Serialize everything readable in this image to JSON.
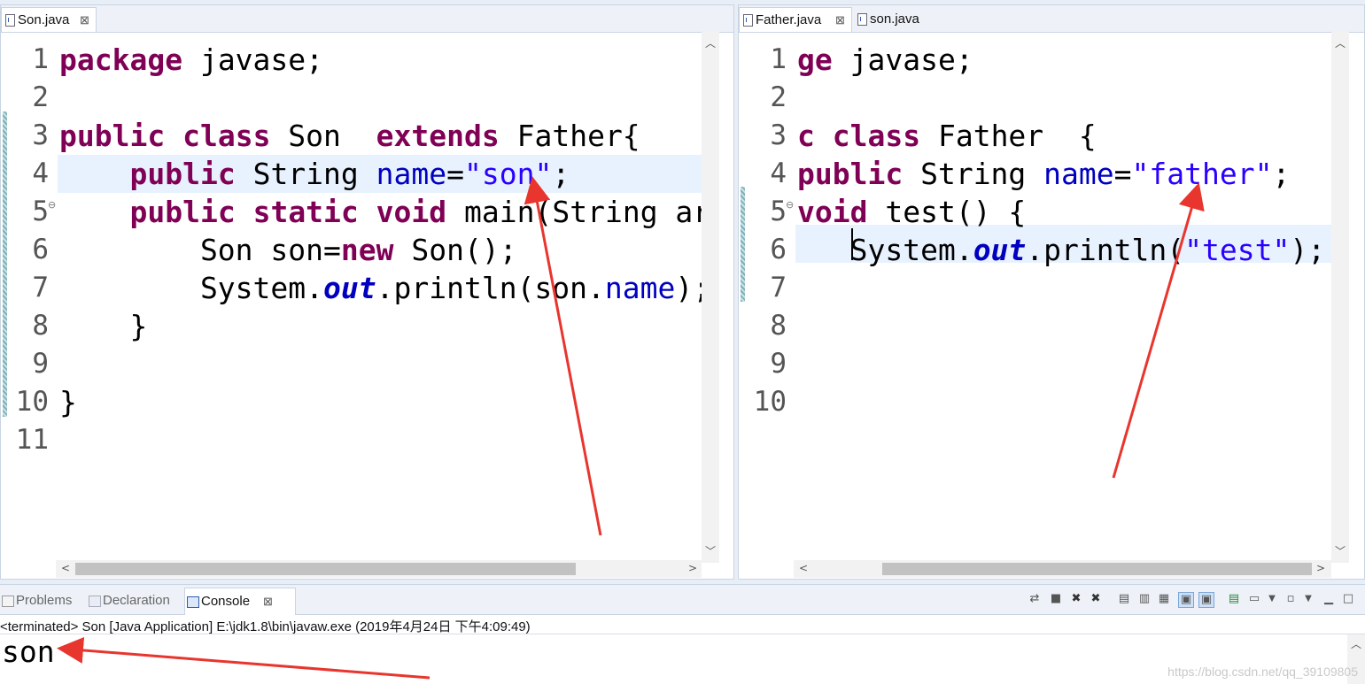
{
  "left_editor": {
    "tab_label": "Son.java",
    "close_glyph": "⊠",
    "line_numbers": [
      "1",
      "2",
      "3",
      "4",
      "5",
      "6",
      "7",
      "8",
      "9",
      "10",
      "11"
    ],
    "lines": [
      [
        {
          "t": "package",
          "c": "kw"
        },
        {
          "t": " javase;",
          "c": ""
        }
      ],
      [],
      [
        {
          "t": "public",
          "c": "kw"
        },
        {
          "t": " ",
          "c": ""
        },
        {
          "t": "class",
          "c": "kw"
        },
        {
          "t": " Son  ",
          "c": ""
        },
        {
          "t": "extends",
          "c": "kw"
        },
        {
          "t": " Father{",
          "c": ""
        }
      ],
      [
        {
          "t": "    ",
          "c": ""
        },
        {
          "t": "public",
          "c": "kw"
        },
        {
          "t": " String ",
          "c": ""
        },
        {
          "t": "name",
          "c": "fld"
        },
        {
          "t": "=",
          "c": ""
        },
        {
          "t": "\"son\"",
          "c": "str"
        },
        {
          "t": ";",
          "c": ""
        }
      ],
      [
        {
          "t": "    ",
          "c": ""
        },
        {
          "t": "public",
          "c": "kw"
        },
        {
          "t": " ",
          "c": ""
        },
        {
          "t": "static",
          "c": "kw"
        },
        {
          "t": " ",
          "c": ""
        },
        {
          "t": "void",
          "c": "kw"
        },
        {
          "t": " main(String ar",
          "c": ""
        }
      ],
      [
        {
          "t": "        Son ",
          "c": ""
        },
        {
          "t": "son",
          "c": ""
        },
        {
          "t": "=",
          "c": ""
        },
        {
          "t": "new",
          "c": "kw"
        },
        {
          "t": " Son();",
          "c": ""
        }
      ],
      [
        {
          "t": "        System.",
          "c": ""
        },
        {
          "t": "out",
          "c": "it"
        },
        {
          "t": ".println(son.",
          "c": ""
        },
        {
          "t": "name",
          "c": "fld"
        },
        {
          "t": ");",
          "c": ""
        }
      ],
      [
        {
          "t": "    }",
          "c": ""
        }
      ],
      [],
      [
        {
          "t": "}",
          "c": ""
        }
      ],
      []
    ]
  },
  "right_editor": {
    "tab_active_label": "Father.java",
    "tab_other_label": "son.java",
    "close_glyph": "⊠",
    "line_numbers": [
      "1",
      "2",
      "3",
      "4",
      "5",
      "6",
      "7",
      "8",
      "9",
      "10"
    ],
    "lines": [
      [
        {
          "t": "ge",
          "c": "kw"
        },
        {
          "t": " javase;",
          "c": ""
        }
      ],
      [],
      [
        {
          "t": "c",
          "c": "kw"
        },
        {
          "t": " ",
          "c": ""
        },
        {
          "t": "class",
          "c": "kw"
        },
        {
          "t": " Father  {",
          "c": ""
        }
      ],
      [
        {
          "t": "public",
          "c": "kw"
        },
        {
          "t": " String ",
          "c": ""
        },
        {
          "t": "name",
          "c": "fld"
        },
        {
          "t": "=",
          "c": ""
        },
        {
          "t": "\"father\"",
          "c": "str"
        },
        {
          "t": ";",
          "c": ""
        }
      ],
      [
        {
          "t": "void",
          "c": "kw"
        },
        {
          "t": " test() {",
          "c": ""
        }
      ],
      [
        {
          "t": "   System.",
          "c": ""
        },
        {
          "t": "out",
          "c": "it"
        },
        {
          "t": ".println(",
          "c": ""
        },
        {
          "t": "\"test\"",
          "c": "str"
        },
        {
          "t": ");",
          "c": ""
        }
      ],
      [],
      [],
      [],
      []
    ]
  },
  "bottom_panel": {
    "tabs": [
      "Problems",
      "Declaration",
      "Console"
    ],
    "close_glyph": "⊠",
    "status_line": "<terminated> Son [Java Application] E:\\jdk1.8\\bin\\javaw.exe (2019年4月24日 下午4:09:49)",
    "output": "son",
    "watermark": "https://blog.csdn.net/qq_39109805"
  },
  "colors": {
    "keyword": "#7f0055",
    "string": "#2a00ff",
    "field": "#0000c0",
    "annotation_arrow": "#e8352e"
  }
}
